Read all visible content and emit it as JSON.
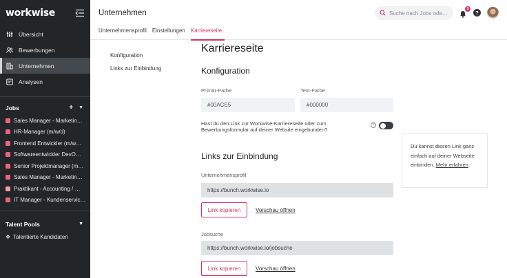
{
  "app": {
    "logo": "workwise"
  },
  "sidebar": {
    "nav": [
      {
        "label": "Übersicht",
        "icon": "sliders-icon"
      },
      {
        "label": "Bewerbungen",
        "icon": "users-icon"
      },
      {
        "label": "Unternehmen",
        "icon": "building-icon",
        "active": true
      },
      {
        "label": "Analysen",
        "icon": "analytics-icon"
      }
    ],
    "jobs_heading": "Jobs",
    "jobs": [
      {
        "label": "Sales Manager - Marketin…",
        "color": "#f06280"
      },
      {
        "label": "HR-Manager (m/w/d)",
        "color": "#f06280"
      },
      {
        "label": "Frontend Entwickler (m/w…",
        "color": "#f06280"
      },
      {
        "label": "Softwareentwickler DevO…",
        "color": "#f06280"
      },
      {
        "label": "Senior Projektmanager (m…",
        "color": "#f06280"
      },
      {
        "label": "Sales Manager - Marketin…",
        "color": "#f06280"
      },
      {
        "label": "Praktikant - Accounting / …",
        "color": "#f59bb0"
      },
      {
        "label": "IT Manager - Kundenservic…",
        "color": "#f06280"
      }
    ],
    "pools_heading": "Talent Pools",
    "pools": [
      {
        "label": "Talentierte Kandidaten"
      }
    ]
  },
  "header": {
    "title": "Unternehmen",
    "tabs": [
      {
        "label": "Unternehmensprofil"
      },
      {
        "label": "Einstellungen"
      },
      {
        "label": "Karriereseite",
        "active": true
      }
    ],
    "search_placeholder": "Suche nach Jobs ode…",
    "notification_count": "5",
    "help": "?"
  },
  "subnav": {
    "items": [
      "Konfiguration",
      "Links zur Einbindung"
    ]
  },
  "main": {
    "title": "Karriereseite",
    "config_heading": "Konfiguration",
    "primary_label": "Primär-Farbe",
    "primary_value": "#00ACE5",
    "text_label": "Text-Farbe",
    "text_value": "#000000",
    "toggle_text": "Hast du den Link zur Workwise-Karriereseite oder zum Bewerbungsformular auf deiner Website eingebunden?",
    "toggle_on": false,
    "links_heading": "Links zur Einbindung",
    "company_label": "Unternehmensprofil",
    "company_url": "https://bunch.workwise.io",
    "jobsearch_label": "Jobsuche",
    "jobsearch_url": "https://bunch.workwise.io/jobsuche",
    "copy_label": "Link kopieren",
    "preview_label": "Vorschau öffnen"
  },
  "help_card": {
    "text": "Du kannst diesen Link ganz einfach auf deiner Webseite einbinden.",
    "link": "Mehr erfahren",
    "end": "."
  },
  "colors": {
    "accent": "#d2345a",
    "sidebar_bg": "#222628"
  }
}
